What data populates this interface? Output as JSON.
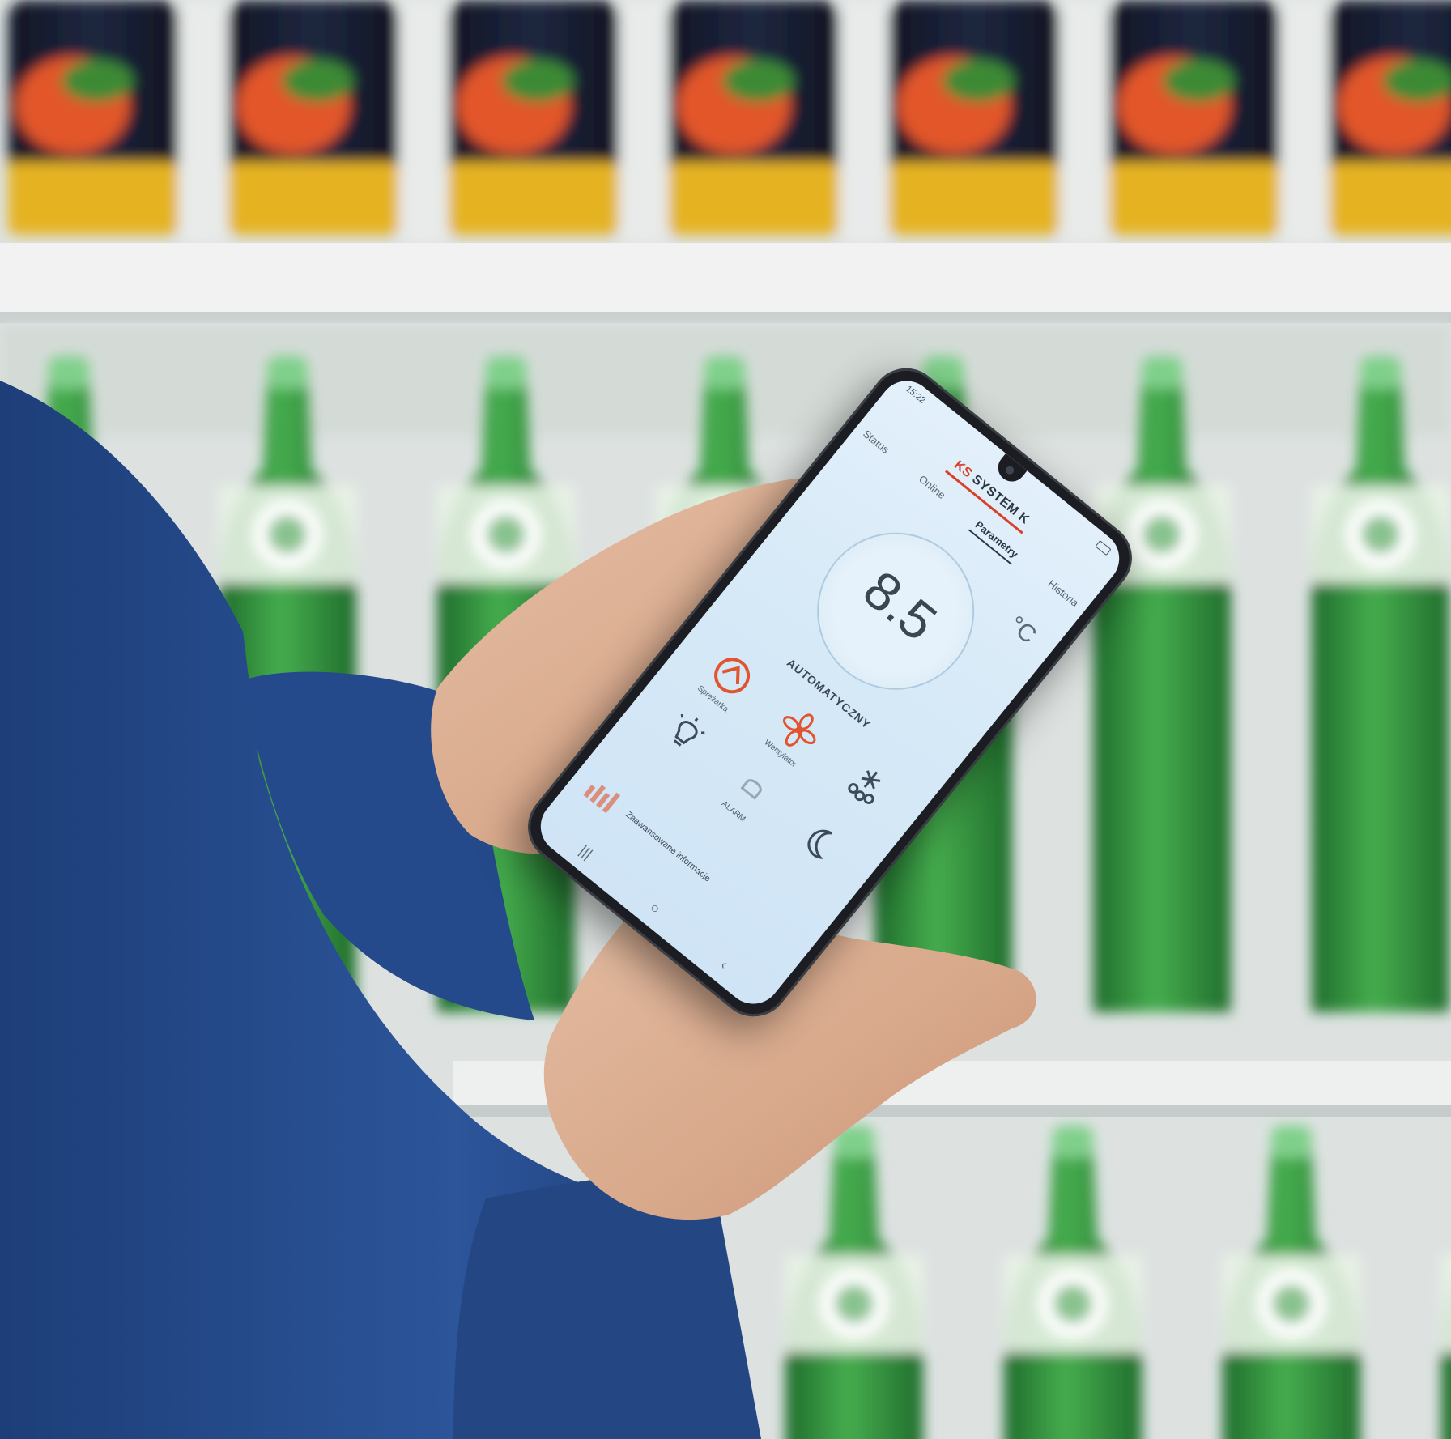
{
  "app": {
    "brand_prefix": "KS",
    "brand_name": "SYSTEM K",
    "status_time": "15:22",
    "tabs": [
      {
        "label": "Status"
      },
      {
        "label": "Online"
      },
      {
        "label": "Parametry",
        "active": true
      },
      {
        "label": "Historia"
      }
    ],
    "temperature": {
      "value": "8.5",
      "unit": "°C"
    },
    "mode_label": "AUTOMATYCZNY",
    "controls": [
      {
        "icon": "compressor-icon",
        "label": "Sprężarka",
        "color": "#e0542f"
      },
      {
        "icon": "fan-icon",
        "label": "Wentylator",
        "color": "#e0542f"
      },
      {
        "icon": "snowflake-defrost-icon",
        "label": "",
        "color": "#3d4a57"
      },
      {
        "icon": "lightbulb-icon",
        "label": "",
        "color": "#3d4a57"
      },
      {
        "icon": "alarm-icon",
        "label": "ALARM",
        "color": "#7f8b96"
      },
      {
        "icon": "night-mode-icon",
        "label": "",
        "color": "#3d4a57"
      }
    ],
    "info_text": "Zaawansowane informacje",
    "history_label": "Historia",
    "nav": [
      "menu-icon",
      "home-icon",
      "back-icon"
    ]
  },
  "colors": {
    "accent": "#d8402a",
    "screen_bg": "#d6e9f7",
    "sleeve": "#2a4f8f",
    "bottle_green": "#2f8f3e"
  }
}
